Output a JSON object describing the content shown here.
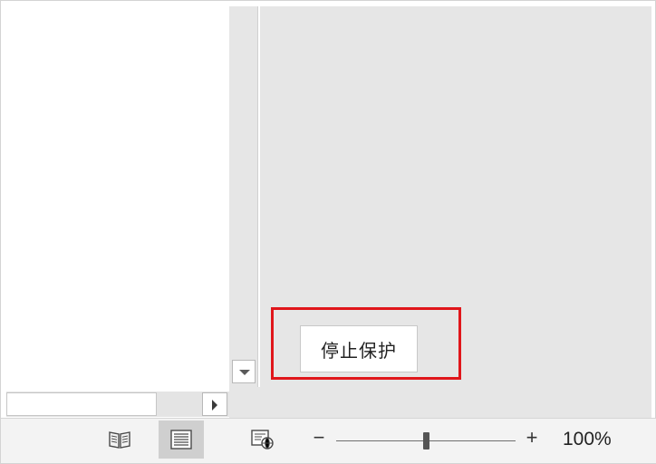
{
  "protect_pane": {
    "stop_protection_label": "停止保护",
    "highlight_color": "#e0161b"
  },
  "statusbar": {
    "views": [
      {
        "name": "read-mode",
        "icon": "book-open-icon",
        "active": false
      },
      {
        "name": "print-layout",
        "icon": "print-layout-icon",
        "active": true
      },
      {
        "name": "web-layout",
        "icon": "web-layout-icon",
        "active": false
      }
    ],
    "zoom": {
      "minus_label": "−",
      "plus_label": "+",
      "level_text": "100%",
      "slider_fraction": 0.5
    }
  }
}
